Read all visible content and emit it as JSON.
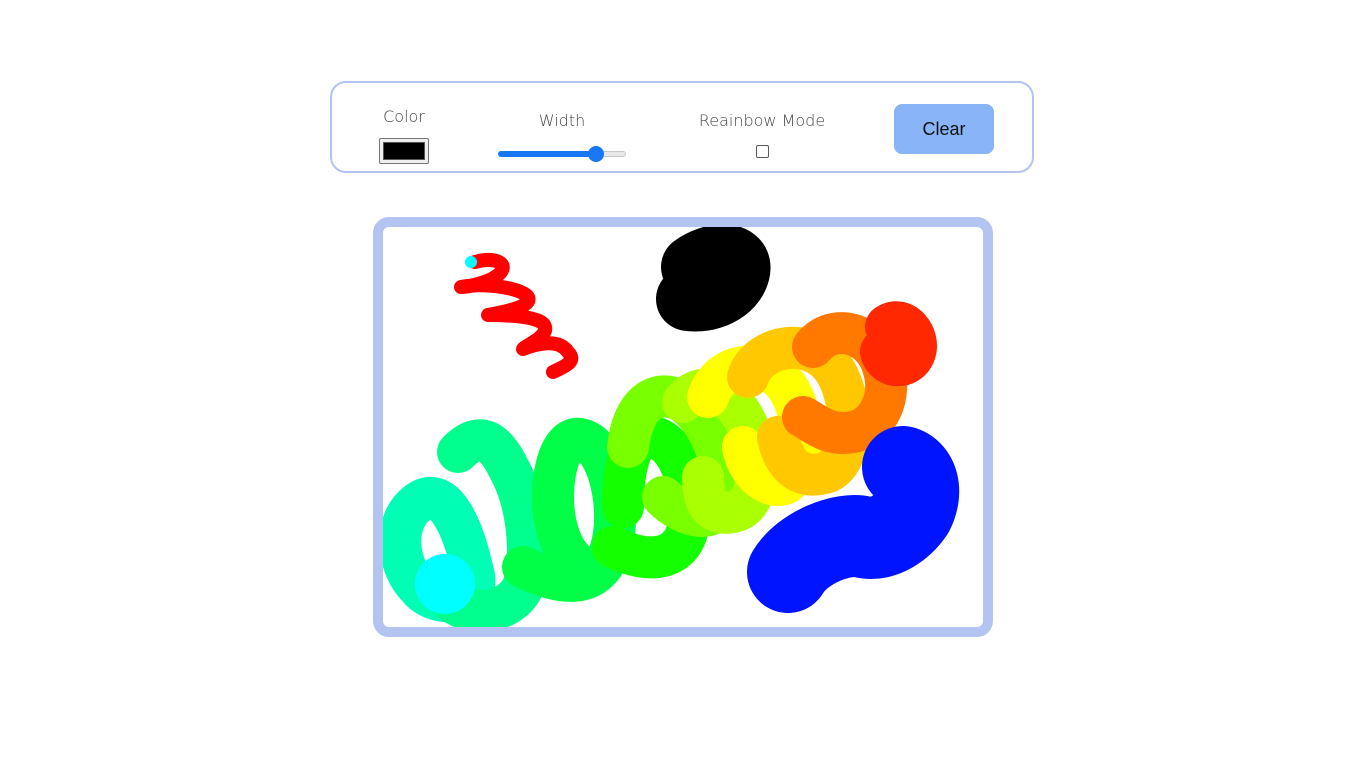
{
  "toolbar": {
    "color_label": "Color",
    "color_value": "#000000",
    "width_label": "Width",
    "width_value_fraction": 0.8,
    "rainbow_label": "Reainbow Mode",
    "rainbow_checked": false,
    "clear_label": "Clear"
  },
  "colors": {
    "border": "#b3c4f1",
    "button": "#8ab4f8",
    "slider_accent": "#1877f2"
  }
}
